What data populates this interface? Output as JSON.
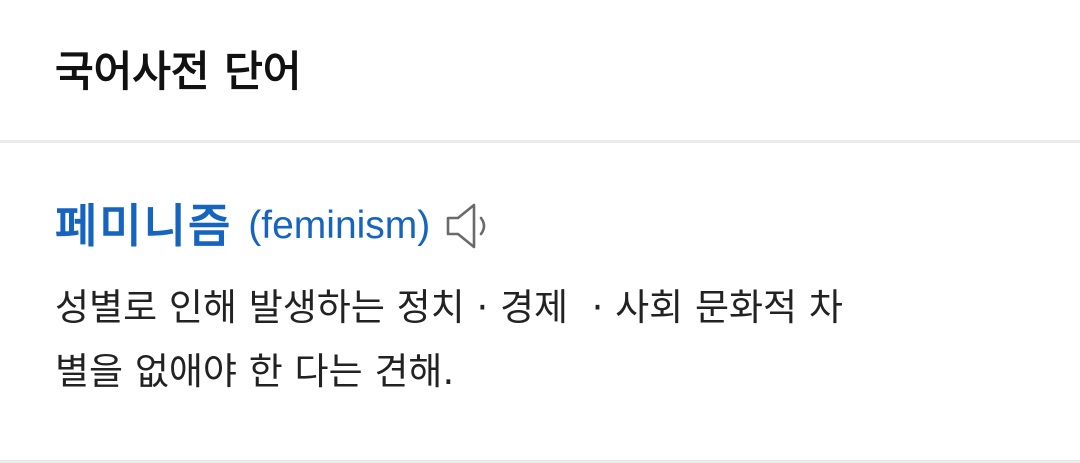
{
  "section": {
    "title": "국어사전 단어"
  },
  "entry": {
    "headword": "페미니즘",
    "origin": "(feminism)",
    "speaker_icon": "speaker-icon",
    "definition": "성별로 인해 발생하는 정치 · 경제  · 사회 문화적 차\n별을 없애야 한 다는 견해."
  },
  "colors": {
    "headword": "#1564c0",
    "title": "#111111",
    "divider": "#ebebeb"
  }
}
